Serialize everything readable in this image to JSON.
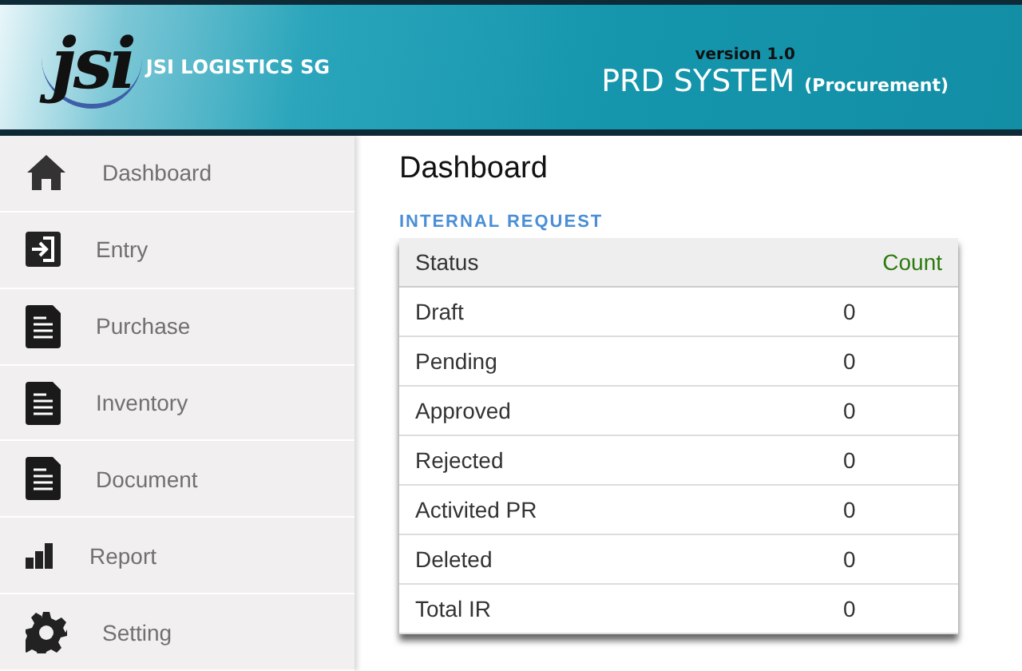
{
  "header": {
    "logo": "jsi",
    "company": "JSI LOGISTICS SG",
    "version": "version 1.0",
    "system": "PRD SYSTEM",
    "subtitle": "(Procurement)"
  },
  "sidebar": {
    "items": [
      {
        "label": "Dashboard",
        "kind": "home"
      },
      {
        "label": "Entry",
        "kind": "entry"
      },
      {
        "label": "Purchase",
        "kind": "document"
      },
      {
        "label": "Inventory",
        "kind": "document"
      },
      {
        "label": "Document",
        "kind": "document"
      },
      {
        "label": "Report",
        "kind": "chart"
      },
      {
        "label": "Setting",
        "kind": "gear"
      }
    ]
  },
  "main": {
    "title": "Dashboard",
    "section": "INTERNAL REQUEST",
    "table": {
      "columns": [
        "Status",
        "Count"
      ],
      "rows": [
        [
          "Draft",
          "0"
        ],
        [
          "Pending",
          "0"
        ],
        [
          "Approved",
          "0"
        ],
        [
          "Rejected",
          "0"
        ],
        [
          "Activited PR",
          "0"
        ],
        [
          "Deleted",
          "0"
        ],
        [
          "Total IR",
          "0"
        ]
      ]
    }
  }
}
